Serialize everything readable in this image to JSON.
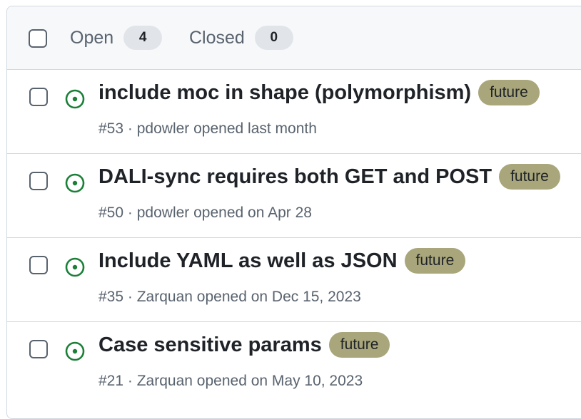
{
  "header": {
    "open_label": "Open",
    "open_count": "4",
    "closed_label": "Closed",
    "closed_count": "0"
  },
  "issues": [
    {
      "title": "include moc in shape (polymorphism)",
      "label": "future",
      "number": "#53",
      "separator": "·",
      "author": "pdowler",
      "opened_text": "opened last month"
    },
    {
      "title": "DALI-sync requires both GET and POST",
      "label": "future",
      "number": "#50",
      "separator": "·",
      "author": "pdowler",
      "opened_text": "opened on Apr 28"
    },
    {
      "title": "Include YAML as well as JSON",
      "label": "future",
      "number": "#35",
      "separator": "·",
      "author": "Zarquan",
      "opened_text": "opened on Dec 15, 2023"
    },
    {
      "title": "Case sensitive params",
      "label": "future",
      "number": "#21",
      "separator": "·",
      "author": "Zarquan",
      "opened_text": "opened on May 10, 2023"
    }
  ],
  "colors": {
    "open_icon": "#1a7f37",
    "label_future": "#a8a67a",
    "header_bg": "#f6f8fa",
    "border": "#d1d9e0",
    "muted_text": "#59636e"
  },
  "icons": {
    "open_issue": "issue-opened-icon"
  }
}
